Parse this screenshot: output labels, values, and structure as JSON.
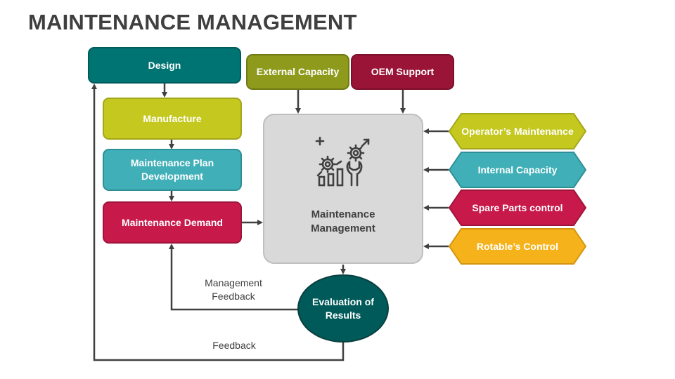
{
  "title": "MAINTENANCE MANAGEMENT",
  "left_flow": [
    {
      "label": "Design",
      "color": "#007373"
    },
    {
      "label": "Manufacture",
      "color": "#c4c81f"
    },
    {
      "label": "Maintenance Plan Development",
      "color": "#40afb7"
    },
    {
      "label": "Maintenance Demand",
      "color": "#c8194b"
    }
  ],
  "top_inputs": [
    {
      "label": "External Capacity",
      "color": "#8e9a1b"
    },
    {
      "label": "OEM Support",
      "color": "#991437"
    }
  ],
  "right_inputs": [
    {
      "label": "Operator’s Maintenance",
      "color": "#c4c81f"
    },
    {
      "label": "Internal Capacity",
      "color": "#40afb7"
    },
    {
      "label": "Spare Parts control",
      "color": "#c8194b"
    },
    {
      "label": "Rotable’s Control",
      "color": "#f6b21a"
    }
  ],
  "center": {
    "label_line1": "Maintenance",
    "label_line2": "Management",
    "icon": "gears-chart-wrench-icon"
  },
  "evaluation": {
    "label_line1": "Evaluation of",
    "label_line2": "Results",
    "color": "#005a5a"
  },
  "feedback_labels": {
    "management_line1": "Management",
    "management_line2": "Feedback",
    "feedback": "Feedback"
  }
}
